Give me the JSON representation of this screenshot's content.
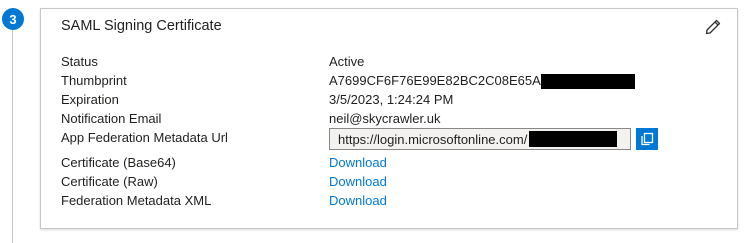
{
  "step": {
    "number": "3"
  },
  "card": {
    "title": "SAML Signing Certificate",
    "edit_icon": "pencil-icon"
  },
  "fields": {
    "status": {
      "label": "Status",
      "value": "Active"
    },
    "thumbprint": {
      "label": "Thumbprint",
      "value": "A7699CF6F76E99E82BC2C08E65A"
    },
    "expiration": {
      "label": "Expiration",
      "value": "3/5/2023, 1:24:24 PM"
    },
    "notification_email": {
      "label": "Notification Email",
      "value": "neil@skycrawler.uk"
    },
    "metadata_url": {
      "label": "App Federation Metadata Url",
      "value": "https://login.microsoftonline.com/",
      "copy_icon": "copy-icon"
    },
    "cert_base64": {
      "label": "Certificate (Base64)",
      "link": "Download"
    },
    "cert_raw": {
      "label": "Certificate (Raw)",
      "link": "Download"
    },
    "federation_xml": {
      "label": "Federation Metadata XML",
      "link": "Download"
    }
  },
  "colors": {
    "accent": "#0078d4",
    "border": "#c8c6c4",
    "redaction": "#000000"
  }
}
